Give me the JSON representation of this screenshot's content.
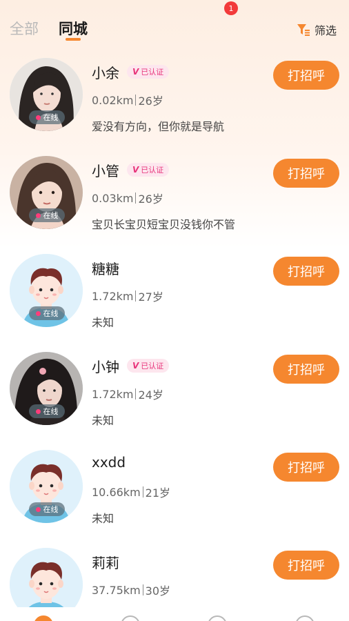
{
  "tabs": {
    "all": "全部",
    "city": "同城"
  },
  "filter": {
    "label": "筛选",
    "icon": "filter-funnel-icon"
  },
  "online_label": "在线",
  "verified_label": "已认证",
  "greet_label": "打招呼",
  "colors": {
    "accent": "#f5872f",
    "verified": "#e8337a",
    "online_dot": "#ff3d7a",
    "badge": "#f23a3a"
  },
  "users": [
    {
      "name": "小余",
      "verified": true,
      "distance": "0.02km",
      "age": "26岁",
      "signature": "爱没有方向，但你就是导航",
      "avatar": "photo-1"
    },
    {
      "name": "小管",
      "verified": true,
      "distance": "0.03km",
      "age": "26岁",
      "signature": "宝贝长宝贝短宝贝没钱你不管",
      "avatar": "photo-2"
    },
    {
      "name": "糖糖",
      "verified": false,
      "distance": "1.72km",
      "age": "27岁",
      "signature": "未知",
      "avatar": "default-avatar"
    },
    {
      "name": "小钟",
      "verified": true,
      "distance": "1.72km",
      "age": "24岁",
      "signature": "未知",
      "avatar": "photo-3"
    },
    {
      "name": "xxdd",
      "verified": false,
      "distance": "10.66km",
      "age": "21岁",
      "signature": "未知",
      "avatar": "default-avatar"
    },
    {
      "name": "莉莉",
      "verified": false,
      "distance": "37.75km",
      "age": "30岁",
      "signature": "",
      "avatar": "default-avatar"
    }
  ],
  "bottom_nav": {
    "message_badge": "1"
  }
}
